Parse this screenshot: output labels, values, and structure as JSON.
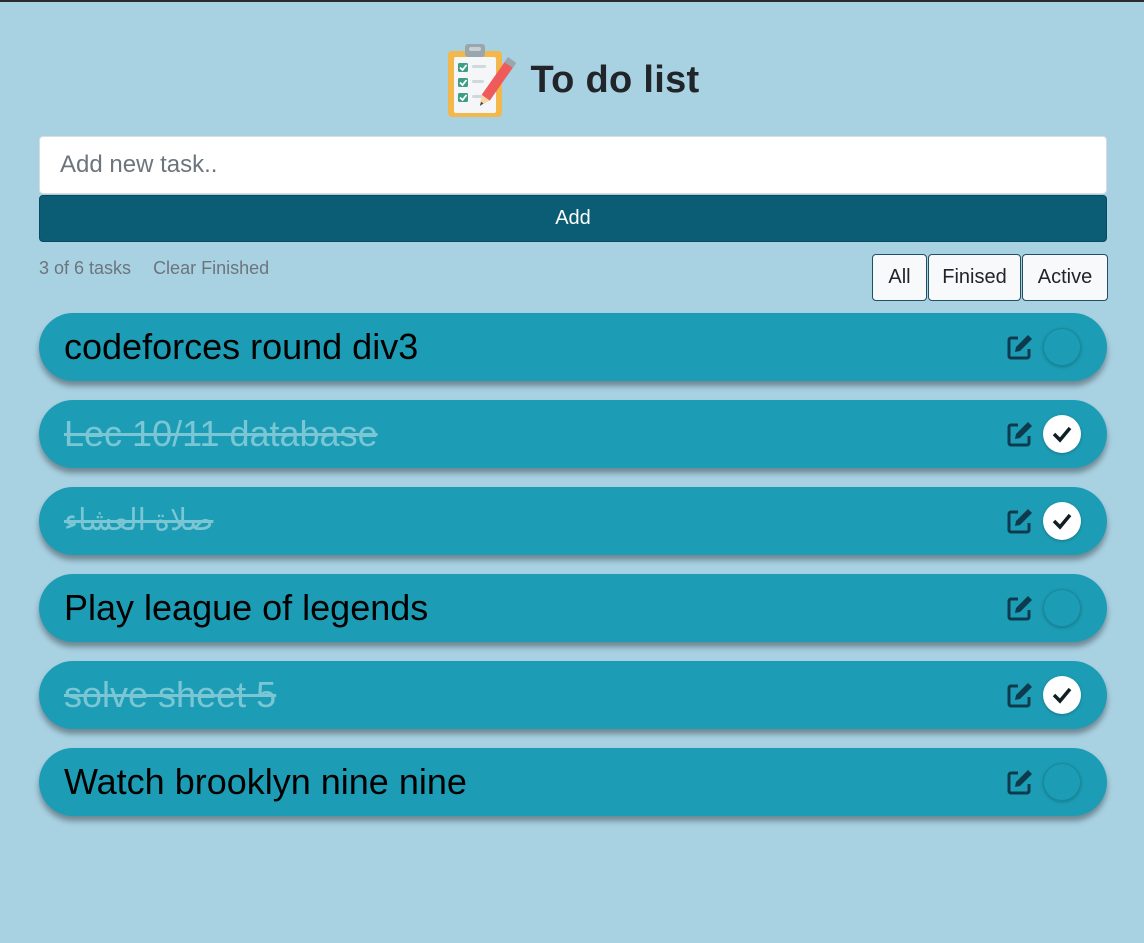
{
  "app": {
    "title": "To do list",
    "logo_icon": "clipboard-checklist-icon"
  },
  "input": {
    "placeholder": "Add new task..",
    "value": ""
  },
  "add_button": {
    "label": "Add"
  },
  "stats": {
    "count_text": "3 of 6 tasks",
    "clear_label": "Clear Finished"
  },
  "filters": {
    "all": "All",
    "finished": "Finised",
    "active": "Active"
  },
  "tasks": [
    {
      "text": "codeforces round div3",
      "done": false
    },
    {
      "text": "Lec 10/11 database",
      "done": true
    },
    {
      "text": "صلاة العشاء",
      "done": true
    },
    {
      "text": "Play league of legends",
      "done": false
    },
    {
      "text": "solve sheet 5",
      "done": true
    },
    {
      "text": "Watch brooklyn nine nine",
      "done": false
    }
  ],
  "colors": {
    "background": "#a8d1e2",
    "accent": "#0b5c75",
    "task_bg": "#1d9db5",
    "done_text": "#7ac6d4"
  },
  "icons": {
    "edit": "edit-icon",
    "check": "check-icon"
  }
}
